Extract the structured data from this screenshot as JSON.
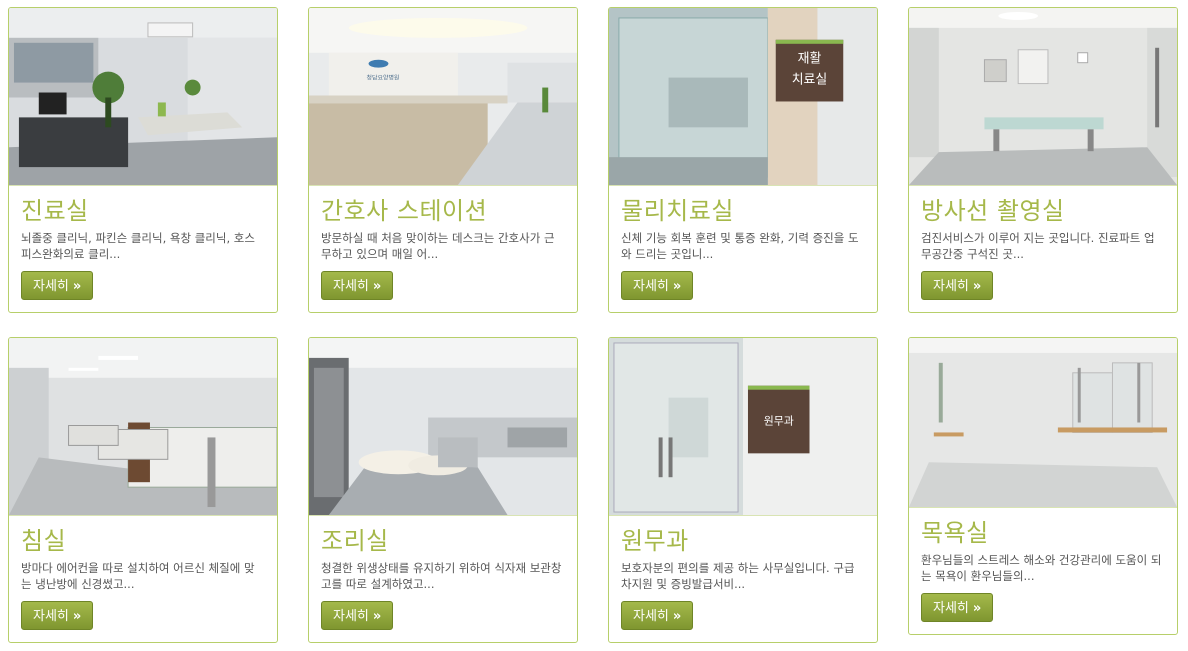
{
  "button_label": "자세히",
  "button_arrow": "»",
  "cards": [
    {
      "title": "진료실",
      "desc": "뇌졸중 클리닉, 파킨슨 클리닉, 욕창 클리닉, 호스피스완화의료 클리...",
      "photo": "examination-room-photo"
    },
    {
      "title": "간호사 스테이션",
      "desc": "방문하실 때 처음 맞이하는 데스크는 간호사가 근무하고 있으며 매일 어...",
      "photo": "nurse-station-photo",
      "sign": "청담요양병원"
    },
    {
      "title": "물리치료실",
      "desc": "신체 기능 회복 훈련 및 통증 완화, 기력 증진을 도와 드리는 곳입니...",
      "photo": "physical-therapy-room-photo",
      "sign": "재활\n치료실"
    },
    {
      "title": "방사선 촬영실",
      "desc": "검진서비스가 이루어 지는 곳입니다. 진료파트 업무공간중 구석진 곳...",
      "photo": "radiology-room-photo"
    },
    {
      "title": "침실",
      "desc": "방마다 에어컨을 따로 설치하여 어르신 체질에 맞는 냉난방에 신경썼고...",
      "photo": "bedroom-photo"
    },
    {
      "title": "조리실",
      "desc": "청결한 위생상태를 유지하기 위하여 식자재 보관창고를 따로 설계하였고...",
      "photo": "kitchen-photo"
    },
    {
      "title": "원무과",
      "desc": "보호자분의 편의를 제공 하는 사무실입니다. 구급차지원 및 증빙발급서비...",
      "photo": "admin-office-photo",
      "sign": "원무과"
    },
    {
      "title": "목욕실",
      "desc": "환우님들의 스트레스 해소와 건강관리에 도움이 되는 목욕이 환우님들의...",
      "photo": "bathroom-photo"
    }
  ]
}
